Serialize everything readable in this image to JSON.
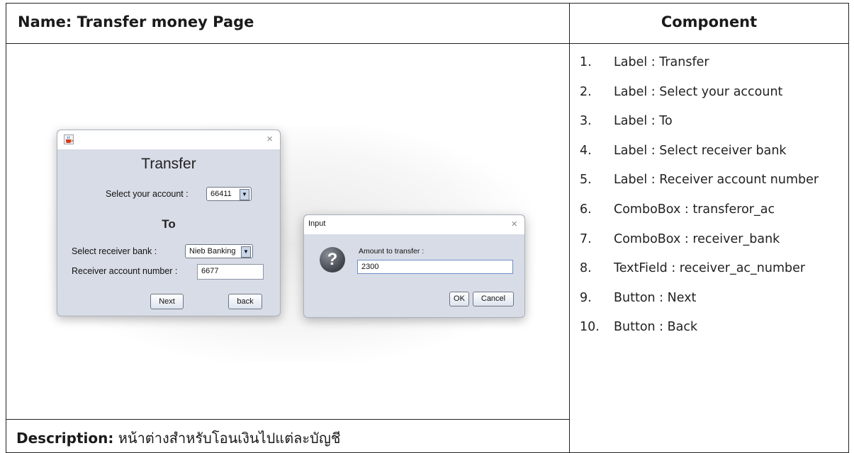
{
  "header": {
    "name_label": "Name:",
    "name_value": "Transfer money Page",
    "component_title": "Component"
  },
  "description": {
    "label": "Description:",
    "text": "หน้าต่างสำหรับโอนเงินไปแต่ละบัญชี"
  },
  "components": [
    {
      "num": "1.",
      "text": "Label : Transfer"
    },
    {
      "num": "2.",
      "text": "Label : Select your account"
    },
    {
      "num": "3.",
      "text": "Label : To"
    },
    {
      "num": "4.",
      "text": "Label : Select receiver bank"
    },
    {
      "num": "5.",
      "text": "Label : Receiver account number"
    },
    {
      "num": "6.",
      "text": "ComboBox : transferor_ac"
    },
    {
      "num": "7.",
      "text": "ComboBox : receiver_bank"
    },
    {
      "num": "8.",
      "text": "TextField : receiver_ac_number"
    },
    {
      "num": "9.",
      "text": "Button : Next"
    },
    {
      "num": "10.",
      "text": "Button : Back"
    }
  ],
  "transfer_window": {
    "title": "Transfer",
    "select_account_label": "Select your account :",
    "account_value": "66411",
    "to_label": "To",
    "select_bank_label": "Select receiver bank :",
    "bank_value": "Nieb Banking",
    "receiver_label": "Receiver account number :",
    "receiver_value": "6677",
    "next_label": "Next",
    "back_label": "back",
    "close_glyph": "×",
    "dropdown_glyph": "▼"
  },
  "input_dialog": {
    "title": "Input",
    "prompt": "Amount to transfer :",
    "amount_value": "2300",
    "ok_label": "OK",
    "cancel_label": "Cancel",
    "close_glyph": "×",
    "question_glyph": "?"
  },
  "icons": {
    "java_app_icon": "java-cup-icon",
    "question_icon": "question-icon"
  }
}
